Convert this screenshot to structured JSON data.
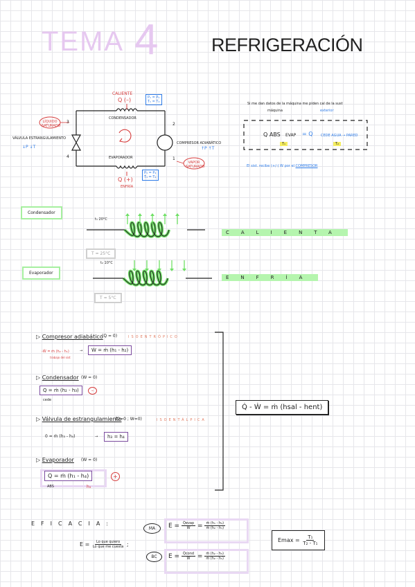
{
  "header": {
    "tema": "TEMA",
    "number": "4",
    "subject": "REFRIGERACIÓN"
  },
  "cycle": {
    "heat_hot_label": "CALIENTE",
    "heat_hot_symbol": "Q (–)",
    "pressure_top_1": "P₁ = P₂",
    "pressure_top_2": "T₁ = T₂",
    "condenser": "CONDENSADOR",
    "evaporator": "EVAPORADOR",
    "valve_label": "VÁLVULA ESTRANGULAMIENTO",
    "valve_effect": "↓P ↓T",
    "compressor_label": "COMPRESOR ADIABÁTICO",
    "compressor_effect": "↑P ↑T",
    "liquid_mix": "LÍQUIDO SATURADO",
    "vapor_sat": "VAPOR SATURADO",
    "heat_cold_symbol": "Q (+)",
    "heat_cold_label": "ENFRÍA",
    "pressure_bot_1": "P₃ = P₄",
    "pressure_bot_2": "T₃ = T₄",
    "p1": "1",
    "p2": "2",
    "p3": "3",
    "p4": "4"
  },
  "note": {
    "intro": "Si me dan datos de la máquina me piden cal de la sust",
    "machine_label": "máquina",
    "outside_label": "exterior",
    "q_abs": "Q ABS",
    "evap": "EVAP",
    "equals": "= Q",
    "cede": "CEDE AGUA → PARED",
    "t1": "T₁",
    "t2": "T₂",
    "conclusion_prefix": "El sist. recibe (+/-) W por el",
    "conclusion_highlight": "COMPRESOR"
  },
  "coils": {
    "condenser_tag": "Condensador",
    "condenser_temp": "t₁ 20°C",
    "condenser_state": "CALIENTA",
    "condenser_grey": "T = 25°C",
    "evaporator_tag": "Evaporador",
    "evaporator_temp": "t₂ 10°C",
    "evaporator_state": "ENFRÍA",
    "evaporator_grey": "T = 5°C"
  },
  "equations": {
    "e1_title": "Compresor adiabático",
    "e1_cond": "(Q = 0)",
    "e1_tag": "ISOENTRÓPICO",
    "e1_left": "-Ẇ = ṁ (h₂ - h₁)",
    "e1_left_note": "trabajo del sist",
    "e1_right": "Ẇ = ṁ (h₁ - h₂)",
    "e2_title": "Condensador",
    "e2_cond": "(W = 0)",
    "e2_box": "Q = ṁ (h₂ - h₃)",
    "e2_note": "cede",
    "e3_title": "Válvula de estrangulamiento",
    "e3_cond": "(Q=0 ; W=0)",
    "e3_tag": "ISOENTÁLPICA",
    "e3_left": "0 = ṁ (h₃ - h₄)",
    "e3_right": "h₃ = h₄",
    "e4_title": "Evaporador",
    "e4_cond": "(W = 0)",
    "e4_box": "Q = ṁ (h₁ - h₄)",
    "e4_note": "ABS",
    "e4_sub": "h₃",
    "general": "Q̇ - Ẇ = ṁ (hsal - hent)"
  },
  "eficacia": {
    "title": "EFICACIA:",
    "def_num": "Lo que quiero",
    "def_den": "Lo que me cuesta",
    "ma_tag": "MA",
    "ma_num": "Q̇evap",
    "ma_den": "Ẇ",
    "ma_rhs_num": "ṁ (h₁ - h₄)",
    "ma_rhs_den": "ṁ (h₂ - h₁)",
    "bc_tag": "BC",
    "bc_num": "Q̇cond",
    "bc_den": "Ẇ",
    "bc_rhs_num": "ṁ (h₂ - h₃)",
    "bc_rhs_den": "ṁ (h₂ - h₁)",
    "emax": "Emax =",
    "emax_num": "T₁",
    "emax_den": "T₂ - T₁"
  }
}
